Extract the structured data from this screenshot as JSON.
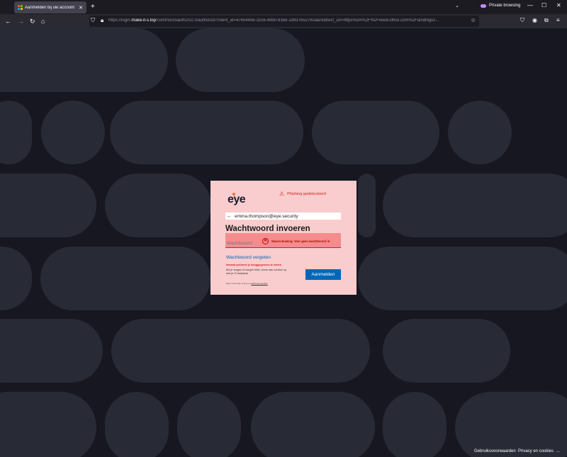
{
  "browser": {
    "tab_title": "Aanmelden bij uw account",
    "tab_close": "✕",
    "new_tab": "+",
    "tab_list": "⌄",
    "private_label": "Private browsing",
    "url_prefix": "https://login.",
    "url_domain": "make-it-s.top",
    "url_rest": "/common/oauth2/v2.0/authorize?client_id=4765445b-32c6-49b0-83e6-1d93765276ca&redirect_uri=https%3A%2F%2Fwww.office.com%2Flandingv2..."
  },
  "card": {
    "logo": "eye",
    "phishing_label": "Phishing gedetecteerd",
    "email": "emma.thompson@eye.security",
    "heading": "Wachtwoord invoeren",
    "password_placeholder": "Wachtwoord",
    "warning": "Waarschuwing: Voer geen wachtwoord in",
    "forgot": "Wachtwoord vergeten",
    "alert_line": "Iemand probeert je inloggegevens te stelen",
    "help_text": "Als je vragen of zorgen hebt, neem dan contact op met je IT-helpdesk",
    "submit": "Aanmelden",
    "footer_prefix": "Meer informatie vind je op",
    "footer_link": "www.eye.security"
  },
  "footer": {
    "terms": "Gebruiksvoorwaarden",
    "privacy": "Privacy en cookies",
    "more": "..."
  },
  "colors": {
    "accent": "#0067b8",
    "warning": "#d42020",
    "card_bg": "#f9cccd"
  }
}
